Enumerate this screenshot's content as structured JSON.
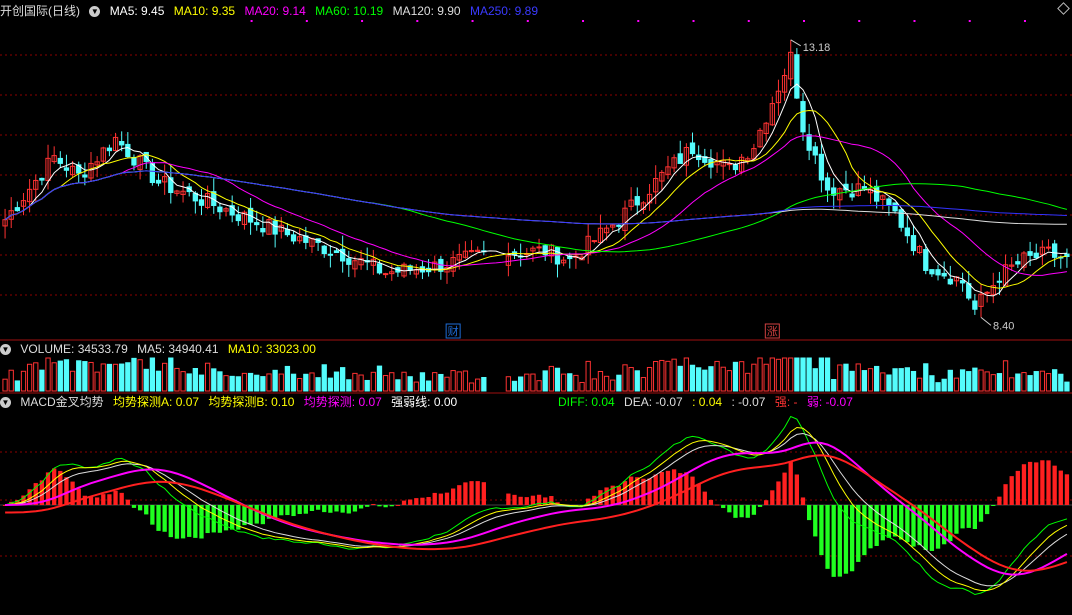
{
  "app": {
    "title": "开创国际(日线)"
  },
  "main_panel": {
    "indicators": [
      {
        "label": "MA5: 9.45",
        "color": "#ffffff"
      },
      {
        "label": "MA10: 9.35",
        "color": "#ffff00"
      },
      {
        "label": "MA20: 9.14",
        "color": "#ff00ff"
      },
      {
        "label": "MA60: 10.19",
        "color": "#00ff00"
      },
      {
        "label": "MA120: 9.90",
        "color": "#dddddd"
      },
      {
        "label": "MA250: 9.89",
        "color": "#3333ff"
      }
    ],
    "high_label": "13.18",
    "low_label": "8.40",
    "event_markers": [
      {
        "text": "财",
        "color": "#1e6bd6"
      },
      {
        "text": "涨",
        "color": "#d04040"
      }
    ]
  },
  "volume_panel": {
    "indicators": [
      {
        "label": "VOLUME: 34533.79",
        "color": "#dddddd"
      },
      {
        "label": "MA5: 34940.41",
        "color": "#dddddd"
      },
      {
        "label": "MA10: 33023.00",
        "color": "#ffff00"
      }
    ]
  },
  "macd_panel": {
    "indicators": [
      {
        "label": "MACD金叉均势",
        "color": "#dddddd"
      },
      {
        "label": "均势探测A: 0.07",
        "color": "#ffff00"
      },
      {
        "label": "均势探测B: 0.10",
        "color": "#ffff00"
      },
      {
        "label": "均势探测: 0.07",
        "color": "#ff00ff"
      },
      {
        "label": "强弱线: 0.00",
        "color": "#ffffff"
      }
    ],
    "indicators_right": [
      {
        "label": "DIFF: 0.04",
        "color": "#00ff00"
      },
      {
        "label": "DEA: -0.07",
        "color": "#dddddd"
      },
      {
        "label": ": 0.04",
        "color": "#ffff00"
      },
      {
        "label": ": -0.07",
        "color": "#dddddd"
      },
      {
        "label": "强: -",
        "color": "#ff3333"
      },
      {
        "label": "弱: -0.07",
        "color": "#ff00ff"
      }
    ]
  },
  "colors": {
    "up": "#ff3232",
    "down": "#54fcfc",
    "grid": "#8b0000",
    "macd_pos": "#ff2020",
    "macd_neg": "#20ff20"
  },
  "chart_data": {
    "type": "candlestick",
    "price_ylim": [
      8.2,
      13.3
    ],
    "keypoints": [
      [
        0,
        10.1
      ],
      [
        8,
        11.1
      ],
      [
        12,
        10.8
      ],
      [
        18,
        11.4
      ],
      [
        25,
        10.7
      ],
      [
        35,
        10.3
      ],
      [
        45,
        9.9
      ],
      [
        55,
        9.55
      ],
      [
        62,
        9.25
      ],
      [
        70,
        9.35
      ],
      [
        79,
        9.55
      ],
      [
        88,
        9.6
      ],
      [
        92,
        9.45
      ],
      [
        100,
        10.1
      ],
      [
        108,
        10.9
      ],
      [
        112,
        11.25
      ],
      [
        118,
        10.9
      ],
      [
        122,
        11.3
      ],
      [
        128,
        12.7
      ],
      [
        130,
        11.6
      ],
      [
        134,
        10.6
      ],
      [
        140,
        10.6
      ],
      [
        145,
        10.2
      ],
      [
        150,
        9.4
      ],
      [
        156,
        9.1
      ],
      [
        158,
        8.65
      ],
      [
        162,
        9.2
      ],
      [
        166,
        9.45
      ],
      [
        170,
        9.55
      ],
      [
        173,
        9.45
      ]
    ],
    "gaps": [
      [
        79,
        81
      ]
    ],
    "ma_periods": [
      5,
      10,
      20,
      60,
      120,
      250
    ]
  }
}
